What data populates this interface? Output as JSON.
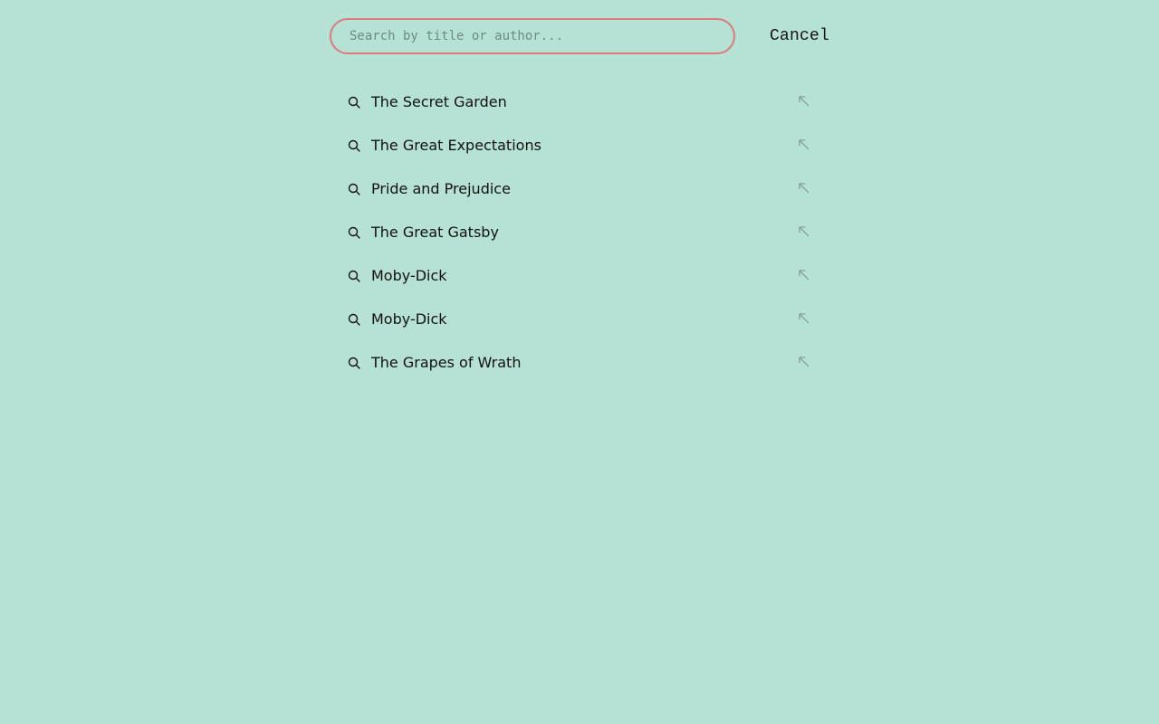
{
  "search": {
    "placeholder": "Search by title or author...",
    "value": ""
  },
  "cancel_label": "Cancel",
  "colors": {
    "background": "#b5e2d4",
    "input_border": "#e07883",
    "text": "#111111",
    "muted_icon": "#8a9c97"
  },
  "suggestions": [
    {
      "label": "The Secret Garden",
      "lead_icon": "search-icon",
      "action_icon": "arrow-up-left-icon"
    },
    {
      "label": "The Great Expectations",
      "lead_icon": "search-icon",
      "action_icon": "arrow-up-left-icon"
    },
    {
      "label": "Pride and Prejudice",
      "lead_icon": "search-icon",
      "action_icon": "arrow-up-left-icon"
    },
    {
      "label": "The Great Gatsby",
      "lead_icon": "search-icon",
      "action_icon": "arrow-up-left-icon"
    },
    {
      "label": "Moby-Dick",
      "lead_icon": "search-icon",
      "action_icon": "arrow-up-left-icon"
    },
    {
      "label": "Moby-Dick",
      "lead_icon": "search-icon",
      "action_icon": "arrow-up-left-icon"
    },
    {
      "label": "The Grapes of Wrath",
      "lead_icon": "search-icon",
      "action_icon": "arrow-up-left-icon"
    }
  ]
}
